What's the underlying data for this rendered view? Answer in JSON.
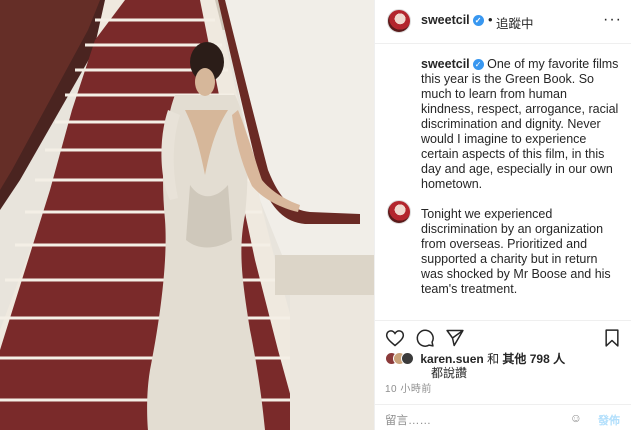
{
  "post": {
    "username": "sweetcil",
    "verified_mark": "✓",
    "follow_dot": "•",
    "follow_status": "追蹤中",
    "more_icon": "···"
  },
  "caption": {
    "username": "sweetcil",
    "paragraph1": "One of my favorite films this year is the Green Book. So much to learn from human kindness, respect, arrogance, racial discrimination and dignity. Never would I imagine to experience certain aspects of this film, in this day and age, especially in our own hometown.",
    "paragraph2": "Tonight we experienced discrimination by an organization from overseas. Prioritized and supported a charity but in return was shocked by Mr Boose and his team's treatment."
  },
  "actions": {
    "heart_icon": "heart-icon",
    "comment_icon": "comment-icon",
    "share_icon": "share-icon",
    "bookmark_icon": "bookmark-icon"
  },
  "likes": {
    "user": "karen.suen",
    "and_text": "和",
    "others": "其他 798 人",
    "line2": "都說讚"
  },
  "timestamp": "10 小時前",
  "comment_bar": {
    "placeholder": "留言……",
    "emoji": "☺",
    "post_label": "發佈"
  },
  "colors": {
    "accent_blue": "#3897f0",
    "carpet_red": "#7a2a2a",
    "stair_cream": "#efe9df"
  }
}
